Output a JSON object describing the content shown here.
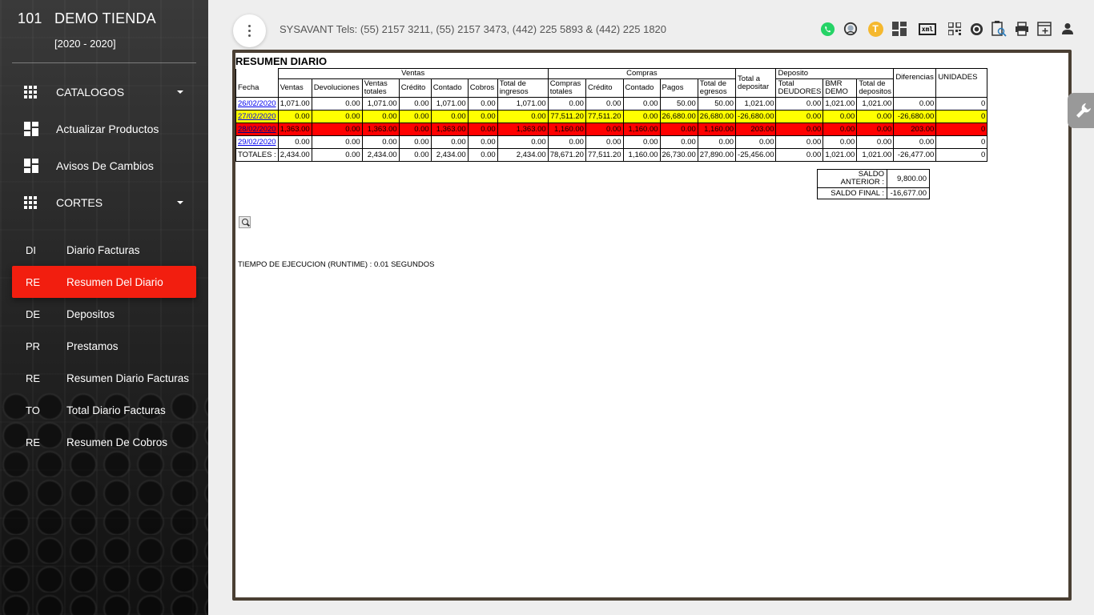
{
  "brand": {
    "code": "101",
    "name": "DEMO TIENDA",
    "year": "[2020 - 2020]"
  },
  "nav": [
    {
      "label": "CATALOGOS",
      "icon": "grid-icon",
      "caret": true
    },
    {
      "label": "Actualizar Productos",
      "icon": "dashboard-icon",
      "caret": false
    },
    {
      "label": "Avisos De Cambios",
      "icon": "dashboard-icon",
      "caret": false
    },
    {
      "label": "CORTES",
      "icon": "grid-icon",
      "caret": true
    }
  ],
  "subnav": [
    {
      "abbr": "DI",
      "label": "Diario Facturas",
      "active": false
    },
    {
      "abbr": "RE",
      "label": "Resumen Del Diario",
      "active": true
    },
    {
      "abbr": "DE",
      "label": "Depositos",
      "active": false
    },
    {
      "abbr": "PR",
      "label": "Prestamos",
      "active": false
    },
    {
      "abbr": "RE",
      "label": "Resumen Diario Facturas",
      "active": false
    },
    {
      "abbr": "TO",
      "label": "Total Diario Facturas",
      "active": false
    },
    {
      "abbr": "RE",
      "label": "Resumen De Cobros",
      "active": false
    }
  ],
  "topbar": {
    "title": "SYSAVANT Tels: (55) 2157 3211, (55) 2157 3473, (442) 225 5893 & (442) 225 1820",
    "icons": [
      "whatsapp-icon",
      "support-icon",
      "t-badge-icon",
      "dashboard-icon",
      "xml-icon",
      "qr-icon",
      "target-icon",
      "clipboard-search-icon",
      "print-icon",
      "add-window-icon",
      "user-icon"
    ],
    "t_badge": "T",
    "xml_label": "xml",
    "colors": {
      "whatsapp": "#25d366",
      "badge": "#f5b82e"
    }
  },
  "report": {
    "title": "RESUMEN DIARIO",
    "group_headers": {
      "ventas": "Ventas",
      "compras": "Compras",
      "total_depositar": "Total a depositar",
      "deposito": "Deposito",
      "diferencias": "Diferencias",
      "unidades": "UNIDADES"
    },
    "columns": {
      "fecha": "Fecha",
      "ventas": [
        "Ventas",
        "Devoluciones",
        "Ventas totales",
        "Crédito",
        "Contado",
        "Cobros",
        "Total de ingresos"
      ],
      "compras": [
        "Compras totales",
        "Crédito",
        "Contado",
        "Pagos",
        "Total de egresos"
      ],
      "deposito": [
        "Total DEUDORES",
        "BMR DEMO",
        "Total de depositos"
      ]
    },
    "rows": [
      {
        "color": "white",
        "cells": [
          "26/02/2020",
          "1,071.00",
          "0.00",
          "1,071.00",
          "0.00",
          "1,071.00",
          "0.00",
          "1,071.00",
          "0.00",
          "0.00",
          "0.00",
          "50.00",
          "50.00",
          "1,021.00",
          "0.00",
          "1,021.00",
          "1,021.00",
          "0.00",
          "0"
        ]
      },
      {
        "color": "yellow",
        "cells": [
          "27/02/2020",
          "0.00",
          "0.00",
          "0.00",
          "0.00",
          "0.00",
          "0.00",
          "0.00",
          "77,511.20",
          "77,511.20",
          "0.00",
          "26,680.00",
          "26,680.00",
          "-26,680.00",
          "0.00",
          "0.00",
          "0.00",
          "-26,680.00",
          "0"
        ]
      },
      {
        "color": "red",
        "cells": [
          "28/02/2020",
          "1,363.00",
          "0.00",
          "1,363.00",
          "0.00",
          "1,363.00",
          "0.00",
          "1,363.00",
          "1,160.00",
          "0.00",
          "1,160.00",
          "0.00",
          "1,160.00",
          "203.00",
          "0.00",
          "0.00",
          "0.00",
          "203.00",
          "0"
        ]
      },
      {
        "color": "white",
        "cells": [
          "29/02/2020",
          "0.00",
          "0.00",
          "0.00",
          "0.00",
          "0.00",
          "0.00",
          "0.00",
          "0.00",
          "0.00",
          "0.00",
          "0.00",
          "0.00",
          "0.00",
          "0.00",
          "0.00",
          "0.00",
          "0.00",
          "0"
        ]
      }
    ],
    "totals": [
      "TOTALES :",
      "2,434.00",
      "0.00",
      "2,434.00",
      "0.00",
      "2,434.00",
      "0.00",
      "2,434.00",
      "78,671.20",
      "77,511.20",
      "1,160.00",
      "26,730.00",
      "27,890.00",
      "-25,456.00",
      "0.00",
      "1,021.00",
      "1,021.00",
      "-26,477.00",
      "0"
    ],
    "saldo_anterior_label": "SALDO ANTERIOR :",
    "saldo_anterior": "9,800.00",
    "saldo_final_label": "SALDO FINAL :",
    "saldo_final": "-16,677.00",
    "runtime": "TIEMPO DE EJECUCION (RUNTIME) : 0.01 SEGUNDOS"
  },
  "colors": {
    "active_nav": "#f21e0f",
    "row_yellow": "#ffff00",
    "row_red": "#ff0000"
  }
}
